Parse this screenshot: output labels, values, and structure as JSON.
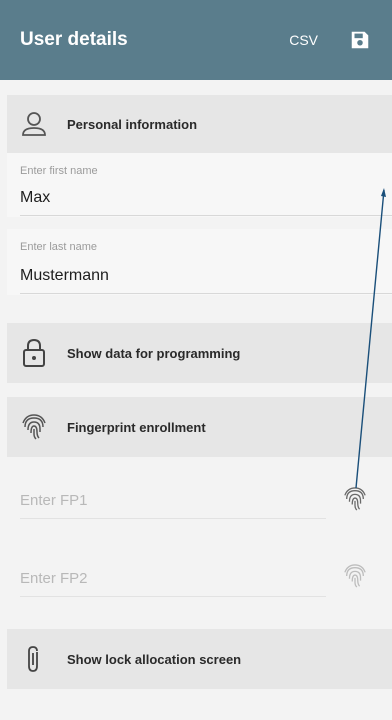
{
  "header": {
    "title": "User details",
    "csv_label": "CSV",
    "save_icon": "save-icon"
  },
  "personal": {
    "label": "Personal information",
    "icon": "person-icon"
  },
  "first_name": {
    "label": "Enter first name",
    "value": "Max"
  },
  "last_name": {
    "label": "Enter last name",
    "value": "Mustermann"
  },
  "programming": {
    "label": "Show data for programming",
    "icon": "lock-icon"
  },
  "fingerprint": {
    "label": "Fingerprint enrollment",
    "icon": "fingerprint-icon",
    "fp1_placeholder": "Enter FP1",
    "fp2_placeholder": "Enter FP2"
  },
  "lock_allocation": {
    "label": "Show lock allocation screen",
    "icon": "paperclip-icon"
  },
  "colors": {
    "appbar": "#5a7d8c",
    "section_bg": "#e6e6e6",
    "pointer": "#1a4f7a"
  }
}
